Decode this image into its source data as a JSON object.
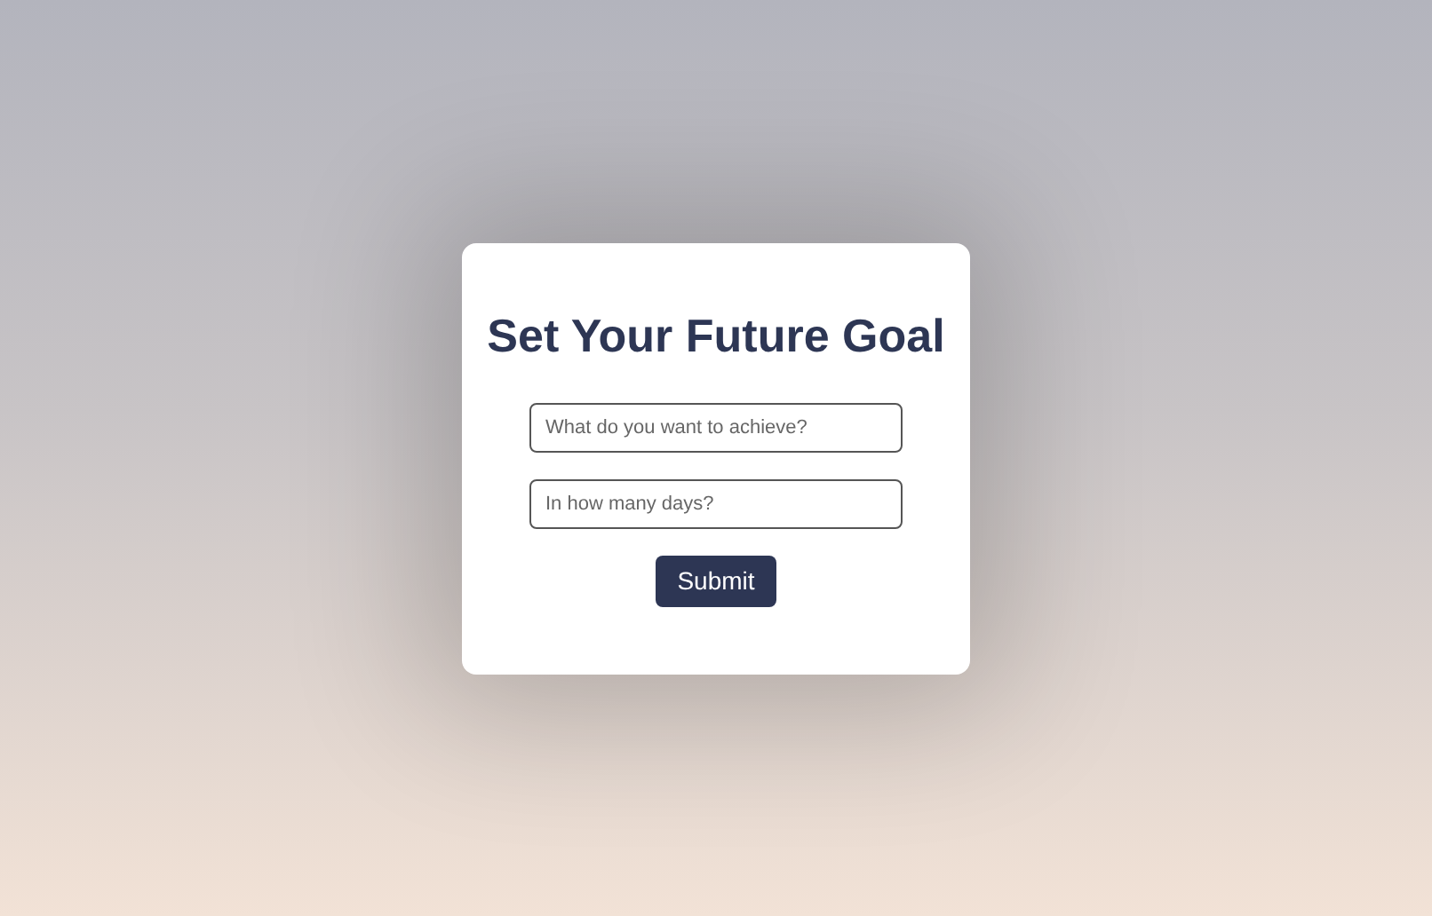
{
  "card": {
    "title": "Set Your Future Goal",
    "fields": [
      {
        "placeholder": "What do you want to achieve?"
      },
      {
        "placeholder": "In how many days?"
      }
    ],
    "button": "Submit"
  }
}
